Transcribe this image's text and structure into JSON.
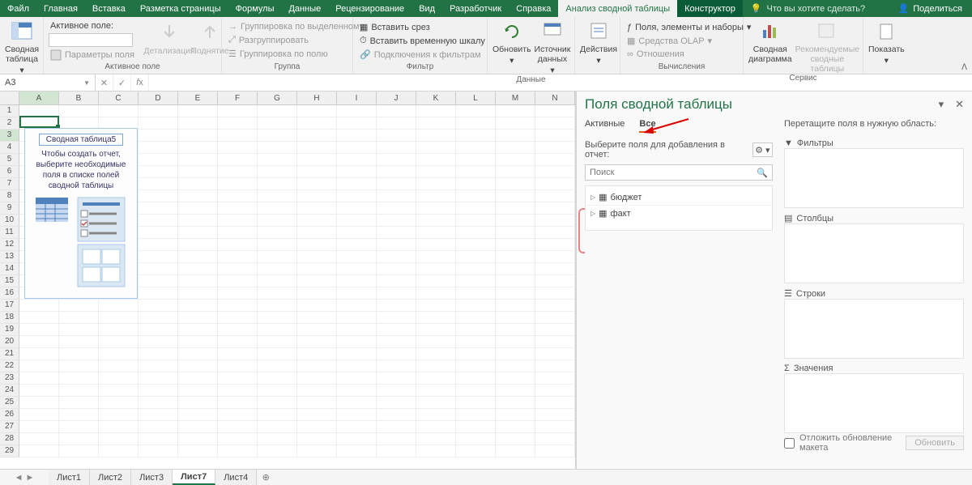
{
  "menu": {
    "tabs": [
      "Файл",
      "Главная",
      "Вставка",
      "Разметка страницы",
      "Формулы",
      "Данные",
      "Рецензирование",
      "Вид",
      "Разработчик",
      "Справка",
      "Анализ сводной таблицы",
      "Конструктор"
    ],
    "active_index": 10,
    "dark_index": 11,
    "search_placeholder": "Что вы хотите сделать?",
    "share": "Поделиться"
  },
  "ribbon": {
    "pivot": {
      "big": "Сводная\nтаблица",
      "label": "",
      "field_label": "Активное поле:",
      "params": "Параметры поля",
      "drill_down": "Детализация",
      "drill_up": "Поднятие",
      "group_label": "Активное поле"
    },
    "group": {
      "g1": "Группировка по выделенному",
      "g2": "Разгруппировать",
      "g3": "Группировка по полю",
      "label": "Группа"
    },
    "filter": {
      "f1": "Вставить срез",
      "f2": "Вставить временную шкалу",
      "f3": "Подключения к фильтрам",
      "label": "Фильтр"
    },
    "data": {
      "refresh": "Обновить",
      "source": "Источник\nданных",
      "label": "Данные"
    },
    "actions": {
      "big": "Действия",
      "label": ""
    },
    "calc": {
      "c1": "Поля, элементы и наборы",
      "c2": "Средства OLAP",
      "c3": "Отношения",
      "label": "Вычисления"
    },
    "tools": {
      "t1": "Сводная\nдиаграмма",
      "t2": "Рекомендуемые\nсводные таблицы",
      "label": "Сервис"
    },
    "show": {
      "big": "Показать",
      "label": ""
    }
  },
  "formula": {
    "namebox": "A3"
  },
  "grid": {
    "cols": [
      "A",
      "B",
      "C",
      "D",
      "E",
      "F",
      "G",
      "H",
      "I",
      "J",
      "K",
      "L",
      "M",
      "N"
    ],
    "rows": 29,
    "selected_col": 0,
    "selected_row": 3,
    "pivot_ph": {
      "title": "Сводная таблица5",
      "text": "Чтобы создать отчет, выберите необходимые поля в списке полей сводной таблицы"
    }
  },
  "pane": {
    "title": "Поля сводной таблицы",
    "tabs": [
      "Активные",
      "Все"
    ],
    "active_tab": 1,
    "hint": "Выберите поля для добавления в отчет:",
    "search_placeholder": "Поиск",
    "fields": [
      "бюджет",
      "факт"
    ],
    "drag_hint": "Перетащите поля в нужную область:",
    "areas": {
      "filters": "Фильтры",
      "cols": "Столбцы",
      "rows": "Строки",
      "vals": "Значения"
    },
    "defer": "Отложить обновление макета",
    "update": "Обновить"
  },
  "sheets": {
    "tabs": [
      "Лист1",
      "Лист2",
      "Лист3",
      "Лист7",
      "Лист4"
    ],
    "active": 3
  }
}
